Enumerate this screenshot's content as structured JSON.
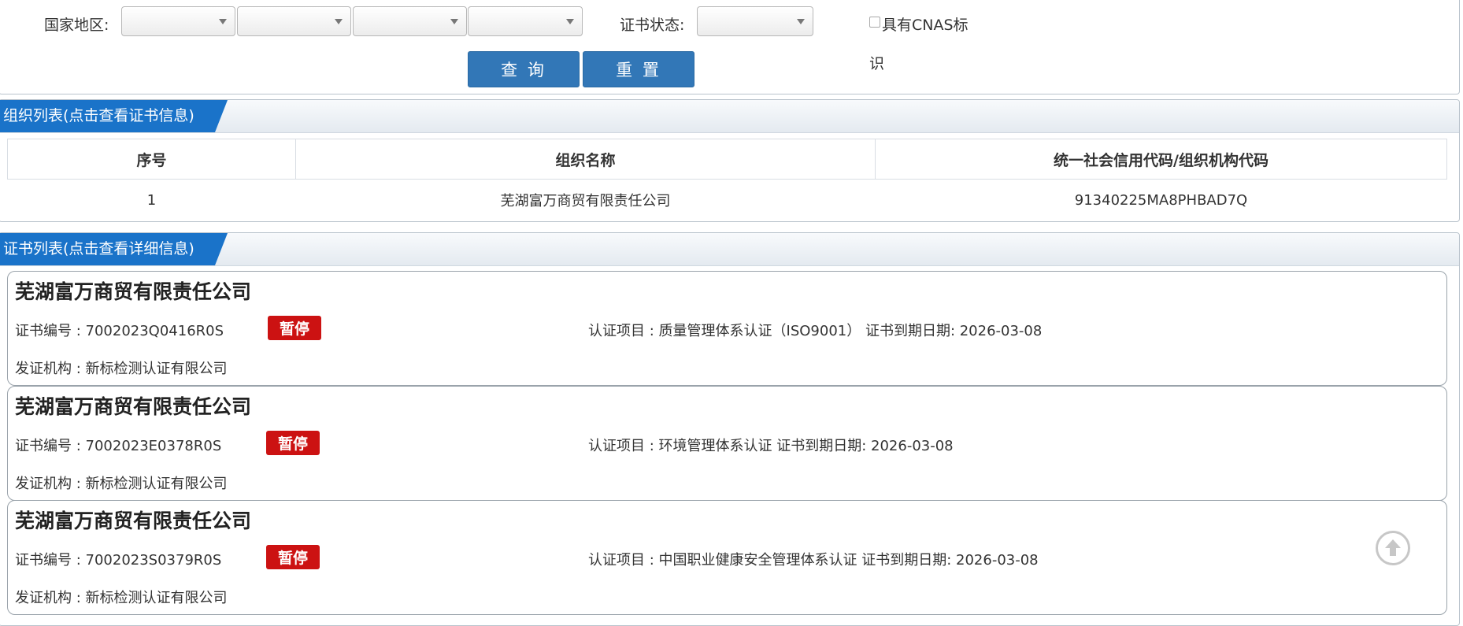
{
  "filter": {
    "region_label": "国家地区:",
    "status_label": "证书状态:",
    "cnas_label_line1": "具有CNAS标",
    "cnas_label_line2": "识",
    "query_button": "查 询",
    "reset_button": "重 置"
  },
  "org_section": {
    "title": "组织列表(点击查看证书信息)",
    "columns": [
      "序号",
      "组织名称",
      "统一社会信用代码/组织机构代码"
    ],
    "rows": [
      {
        "index": "1",
        "name": "芜湖富万商贸有限责任公司",
        "code": "91340225MA8PHBAD7Q"
      }
    ]
  },
  "cert_section": {
    "title": "证书列表(点击查看详细信息)",
    "cards": [
      {
        "company": "芜湖富万商贸有限责任公司",
        "cert_no": "证书编号 : 7002023Q0416R0S",
        "status": "暂停",
        "project": "认证项目 : 质量管理体系认证（ISO9001） 证书到期日期: 2026-03-08",
        "issuer": "发证机构 : 新标检测认证有限公司"
      },
      {
        "company": "芜湖富万商贸有限责任公司",
        "cert_no": "证书编号 : 7002023E0378R0S",
        "status": "暂停",
        "project": "认证项目 : 环境管理体系认证 证书到期日期: 2026-03-08",
        "issuer": "发证机构 : 新标检测认证有限公司"
      },
      {
        "company": "芜湖富万商贸有限责任公司",
        "cert_no": "证书编号 : 7002023S0379R0S",
        "status": "暂停",
        "project": "认证项目 : 中国职业健康安全管理体系认证 证书到期日期: 2026-03-08",
        "issuer": "发证机构 : 新标检测认证有限公司"
      }
    ]
  },
  "colors": {
    "header_tab": "#1a73c9",
    "button": "#3277b7",
    "status_badge": "#cc1212"
  },
  "icons": {
    "back_to_top": "arrow-up-circle-icon"
  }
}
